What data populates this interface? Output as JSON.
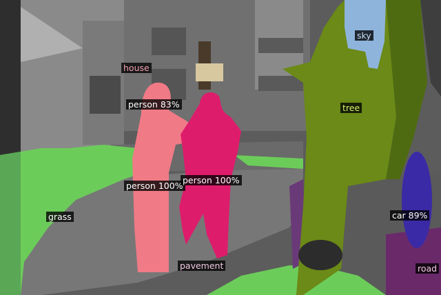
{
  "scene": {
    "description_colors": {
      "sky": "#8fb4dc",
      "tree": "#6b8a17",
      "grass": "#6ccc5a",
      "person_a": "#f07a86",
      "person_b": "#de1c6c",
      "car": "#3a2aa6",
      "road": "#7a2a78",
      "pavement": "#777777",
      "house": "#6d6d6d"
    }
  },
  "labels": [
    {
      "text": "house",
      "color": "#f0a0b0"
    },
    {
      "text": "sky",
      "color": "#c8dcf8"
    },
    {
      "text": "person 83%",
      "color": "#ffffff"
    },
    {
      "text": "tree",
      "color": "#d8f070"
    },
    {
      "text": "person 100%",
      "color": "#ffffff"
    },
    {
      "text": "person 100%",
      "color": "#ffffff"
    },
    {
      "text": "grass",
      "color": "#ffffff"
    },
    {
      "text": "car 89%",
      "color": "#ffffff"
    },
    {
      "text": "pavement",
      "color": "#f0c8e0"
    },
    {
      "text": "road",
      "color": "#f0c8e0"
    }
  ]
}
